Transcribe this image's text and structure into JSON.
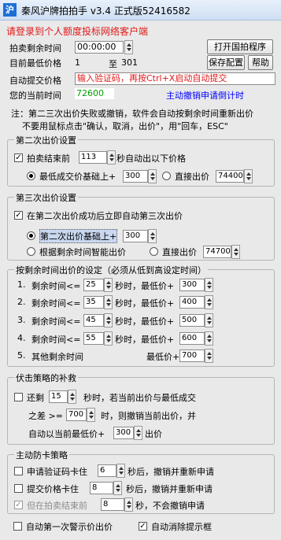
{
  "app": {
    "icon_glyph": "沪",
    "title": "秦风沪牌拍拍手 v3.4 正式版52416582"
  },
  "login_prompt": "请登录到个人额度投标网络客户端",
  "remaining_time": {
    "label": "拍卖剩余时间",
    "value": "00:00:00"
  },
  "open_program_button": "打开国拍程序",
  "min_price": {
    "label": "目前最低价格",
    "from": "1",
    "to_label": "至",
    "to": "301"
  },
  "save_button": "保存配置",
  "help_button": "帮助",
  "auto_submit": {
    "label": "自动提交价格",
    "hint": "输入验证码，再按Ctrl+X启动自动提交"
  },
  "time_row": {
    "label": "您的当前时间",
    "value": "72600",
    "link": "主动撤销申请倒计时"
  },
  "note": {
    "line1": "注：第二三次出价失败或撤销，软件会自动按剩余时间重新出价",
    "line2": "不要用鼠标点击\"确认，取消，出价\"，用\"回车，ESC\""
  },
  "second_bid": {
    "title": "第二次出价设置",
    "check_label": "拍卖结束前",
    "seconds": "113",
    "check_suffix": "秒自动出以下价格",
    "opt_min_label": "最低成交价基础上+",
    "opt_min_value": "300",
    "opt_direct_label": "直接出价",
    "opt_direct_value": "74400"
  },
  "third_bid": {
    "title": "第三次出价设置",
    "check_label": "在第二次出价成功后立即自动第三次出价",
    "opt_base_label": "第二次出价基础上+",
    "opt_base_value": "300",
    "opt_smart_label": "根据剩余时间智能出价",
    "opt_direct_label": "直接出价",
    "opt_direct_value": "74700"
  },
  "time_rules": {
    "title": "按剩余时间出价的设定（必须从低到高设定时间）",
    "rows": [
      {
        "num": "1.",
        "label": "剩余时间<=",
        "sec": "25",
        "mid": "秒时，最低价+",
        "add": "300"
      },
      {
        "num": "2.",
        "label": "剩余时间<=",
        "sec": "35",
        "mid": "秒时，最低价+",
        "add": "400"
      },
      {
        "num": "3.",
        "label": "剩余时间<=",
        "sec": "45",
        "mid": "秒时，最低价+",
        "add": "500"
      },
      {
        "num": "4.",
        "label": "剩余时间<=",
        "sec": "55",
        "mid": "秒时，最低价+",
        "add": "600"
      }
    ],
    "other": {
      "num": "5.",
      "label": "其他剩余时间",
      "mid": "最低价+",
      "add": "700"
    }
  },
  "ambush": {
    "title": "伏击策略的补救",
    "remain_label": "还剩",
    "remain_value": "15",
    "remain_suffix": "秒时，若当前出价与最低成交",
    "diff_label": "之差 >=",
    "diff_value": "700",
    "diff_suffix": "时，则撤销当前出价，并",
    "rebid_label": "自动以当前最低价+",
    "rebid_value": "300",
    "rebid_suffix": "出价"
  },
  "anti_stuck": {
    "title": "主动防卡策略",
    "row1_label": "申请验证码卡住",
    "row1_value": "6",
    "row1_suffix": "秒后，撤销并重新申请",
    "row2_label": "提交价格卡住",
    "row2_value": "8",
    "row2_suffix": "秒后，撤销并重新申请",
    "row3_label": "但在拍卖结束前",
    "row3_value": "8",
    "row3_suffix": "秒，不会撤销申请"
  },
  "bottom": {
    "warn_label": "自动第一次警示价出价",
    "clear_label": "自动消除提示框"
  }
}
